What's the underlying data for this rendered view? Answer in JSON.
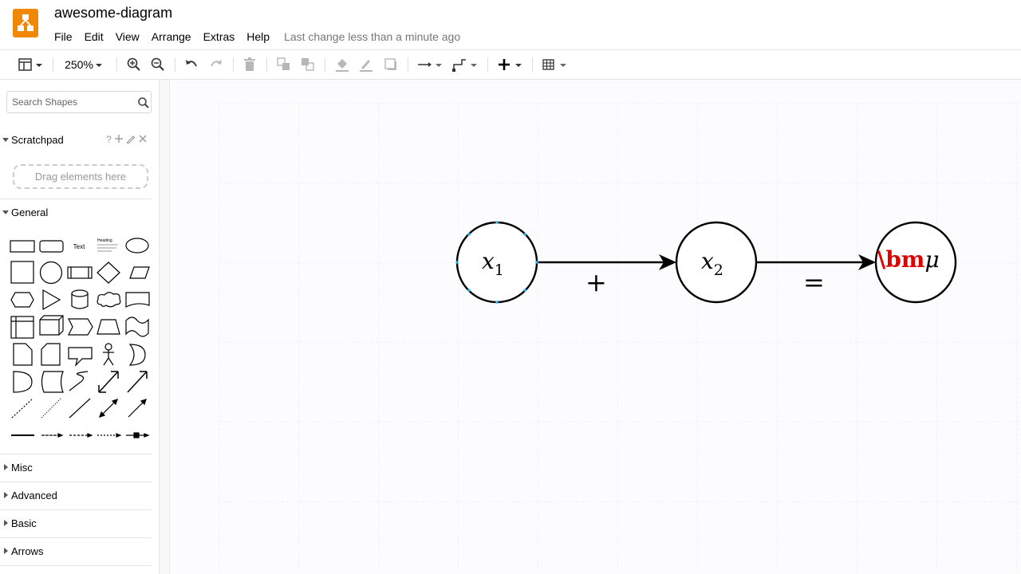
{
  "header": {
    "doc_title": "awesome-diagram",
    "menu": [
      "File",
      "Edit",
      "View",
      "Arrange",
      "Extras",
      "Help"
    ],
    "last_change": "Last change less than a minute ago",
    "accent_color": "#f08705"
  },
  "toolbar": {
    "zoom": "250%",
    "icons": [
      "format-panel-icon",
      "zoom-in-icon",
      "zoom-out-icon",
      "undo-icon",
      "redo-icon",
      "delete-icon",
      "to-front-icon",
      "to-back-icon",
      "fill-color-icon",
      "line-color-icon",
      "shadow-icon",
      "connection-icon",
      "waypoints-icon",
      "insert-icon",
      "table-icon"
    ]
  },
  "sidebar": {
    "search_placeholder": "Search Shapes",
    "scratchpad": {
      "title": "Scratchpad",
      "help": "?",
      "drop_hint": "Drag elements here"
    },
    "general_title": "General",
    "shape_text_label": "Text",
    "shape_heading_label": "Heading",
    "sections": [
      "Misc",
      "Advanced",
      "Basic",
      "Arrows"
    ]
  },
  "diagram": {
    "node1": {
      "var": "x",
      "sub": "1"
    },
    "node2": {
      "var": "x",
      "sub": "2"
    },
    "node3": {
      "prefix": "\\bm",
      "symbol": "μ"
    },
    "edge1_label": "+",
    "edge2_label": "=",
    "accent_red": "#e00000"
  }
}
